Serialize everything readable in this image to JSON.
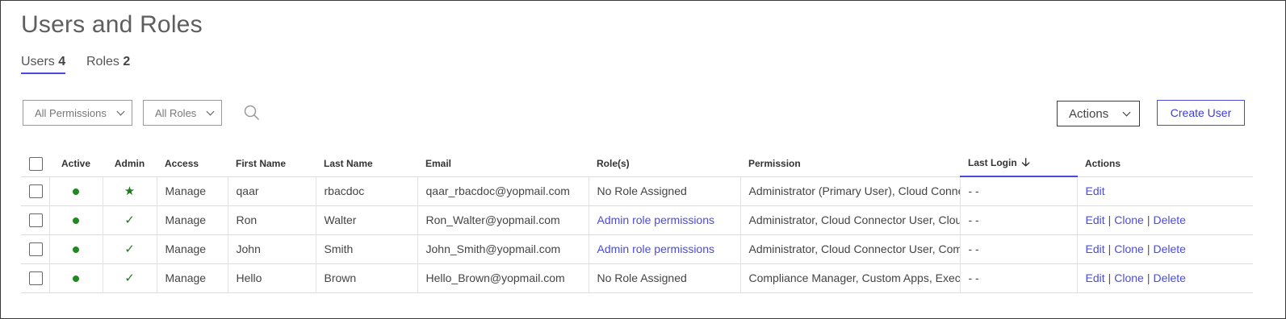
{
  "page": {
    "title": "Users and Roles"
  },
  "tabs": [
    {
      "label": "Users",
      "count": "4"
    },
    {
      "label": "Roles",
      "count": "2"
    }
  ],
  "filters": {
    "permissions": "All Permissions",
    "roles": "All Roles"
  },
  "toolbar": {
    "actions_label": "Actions",
    "create_label": "Create User"
  },
  "colors": {
    "accent": "#4b4be0",
    "status_active": "#1f8a1f"
  },
  "table": {
    "columns": [
      "Active",
      "Admin",
      "Access",
      "First Name",
      "Last Name",
      "Email",
      "Role(s)",
      "Permission",
      "Last Login",
      "Actions"
    ],
    "sorted_column": "Last Login",
    "rows": [
      {
        "access": "Manage",
        "admin": "★",
        "first": "qaar",
        "last": "rbacdoc",
        "email": "qaar_rbacdoc@yopmail.com",
        "roles": "No Role Assigned",
        "permission": "Administrator (Primary User), Cloud Connector User",
        "last_login": "- -",
        "act_edit": "Edit"
      },
      {
        "access": "Manage",
        "admin": "✓",
        "first": "Ron",
        "last": "Walter",
        "email": "Ron_Walter@yopmail.com",
        "roles": "Admin role permissions",
        "permission": "Administrator, Cloud Connector User, Cloud S",
        "last_login": "- -",
        "act_edit": "Edit",
        "act_clone": "Clone",
        "act_delete": "Delete"
      },
      {
        "access": "Manage",
        "admin": "✓",
        "first": "John",
        "last": "Smith",
        "email": "John_Smith@yopmail.com",
        "roles": "Admin role permissions",
        "permission": "Administrator, Cloud Connector User, Compli",
        "last_login": "- -",
        "act_edit": "Edit",
        "act_clone": "Clone",
        "act_delete": "Delete"
      },
      {
        "access": "Manage",
        "admin": "✓",
        "first": "Hello",
        "last": "Brown",
        "email": "Hello_Brown@yopmail.com",
        "roles": "No Role Assigned",
        "permission": "Compliance Manager, Custom Apps, Executive",
        "last_login": "- -",
        "act_edit": "Edit",
        "act_clone": "Clone",
        "act_delete": "Delete"
      }
    ]
  }
}
